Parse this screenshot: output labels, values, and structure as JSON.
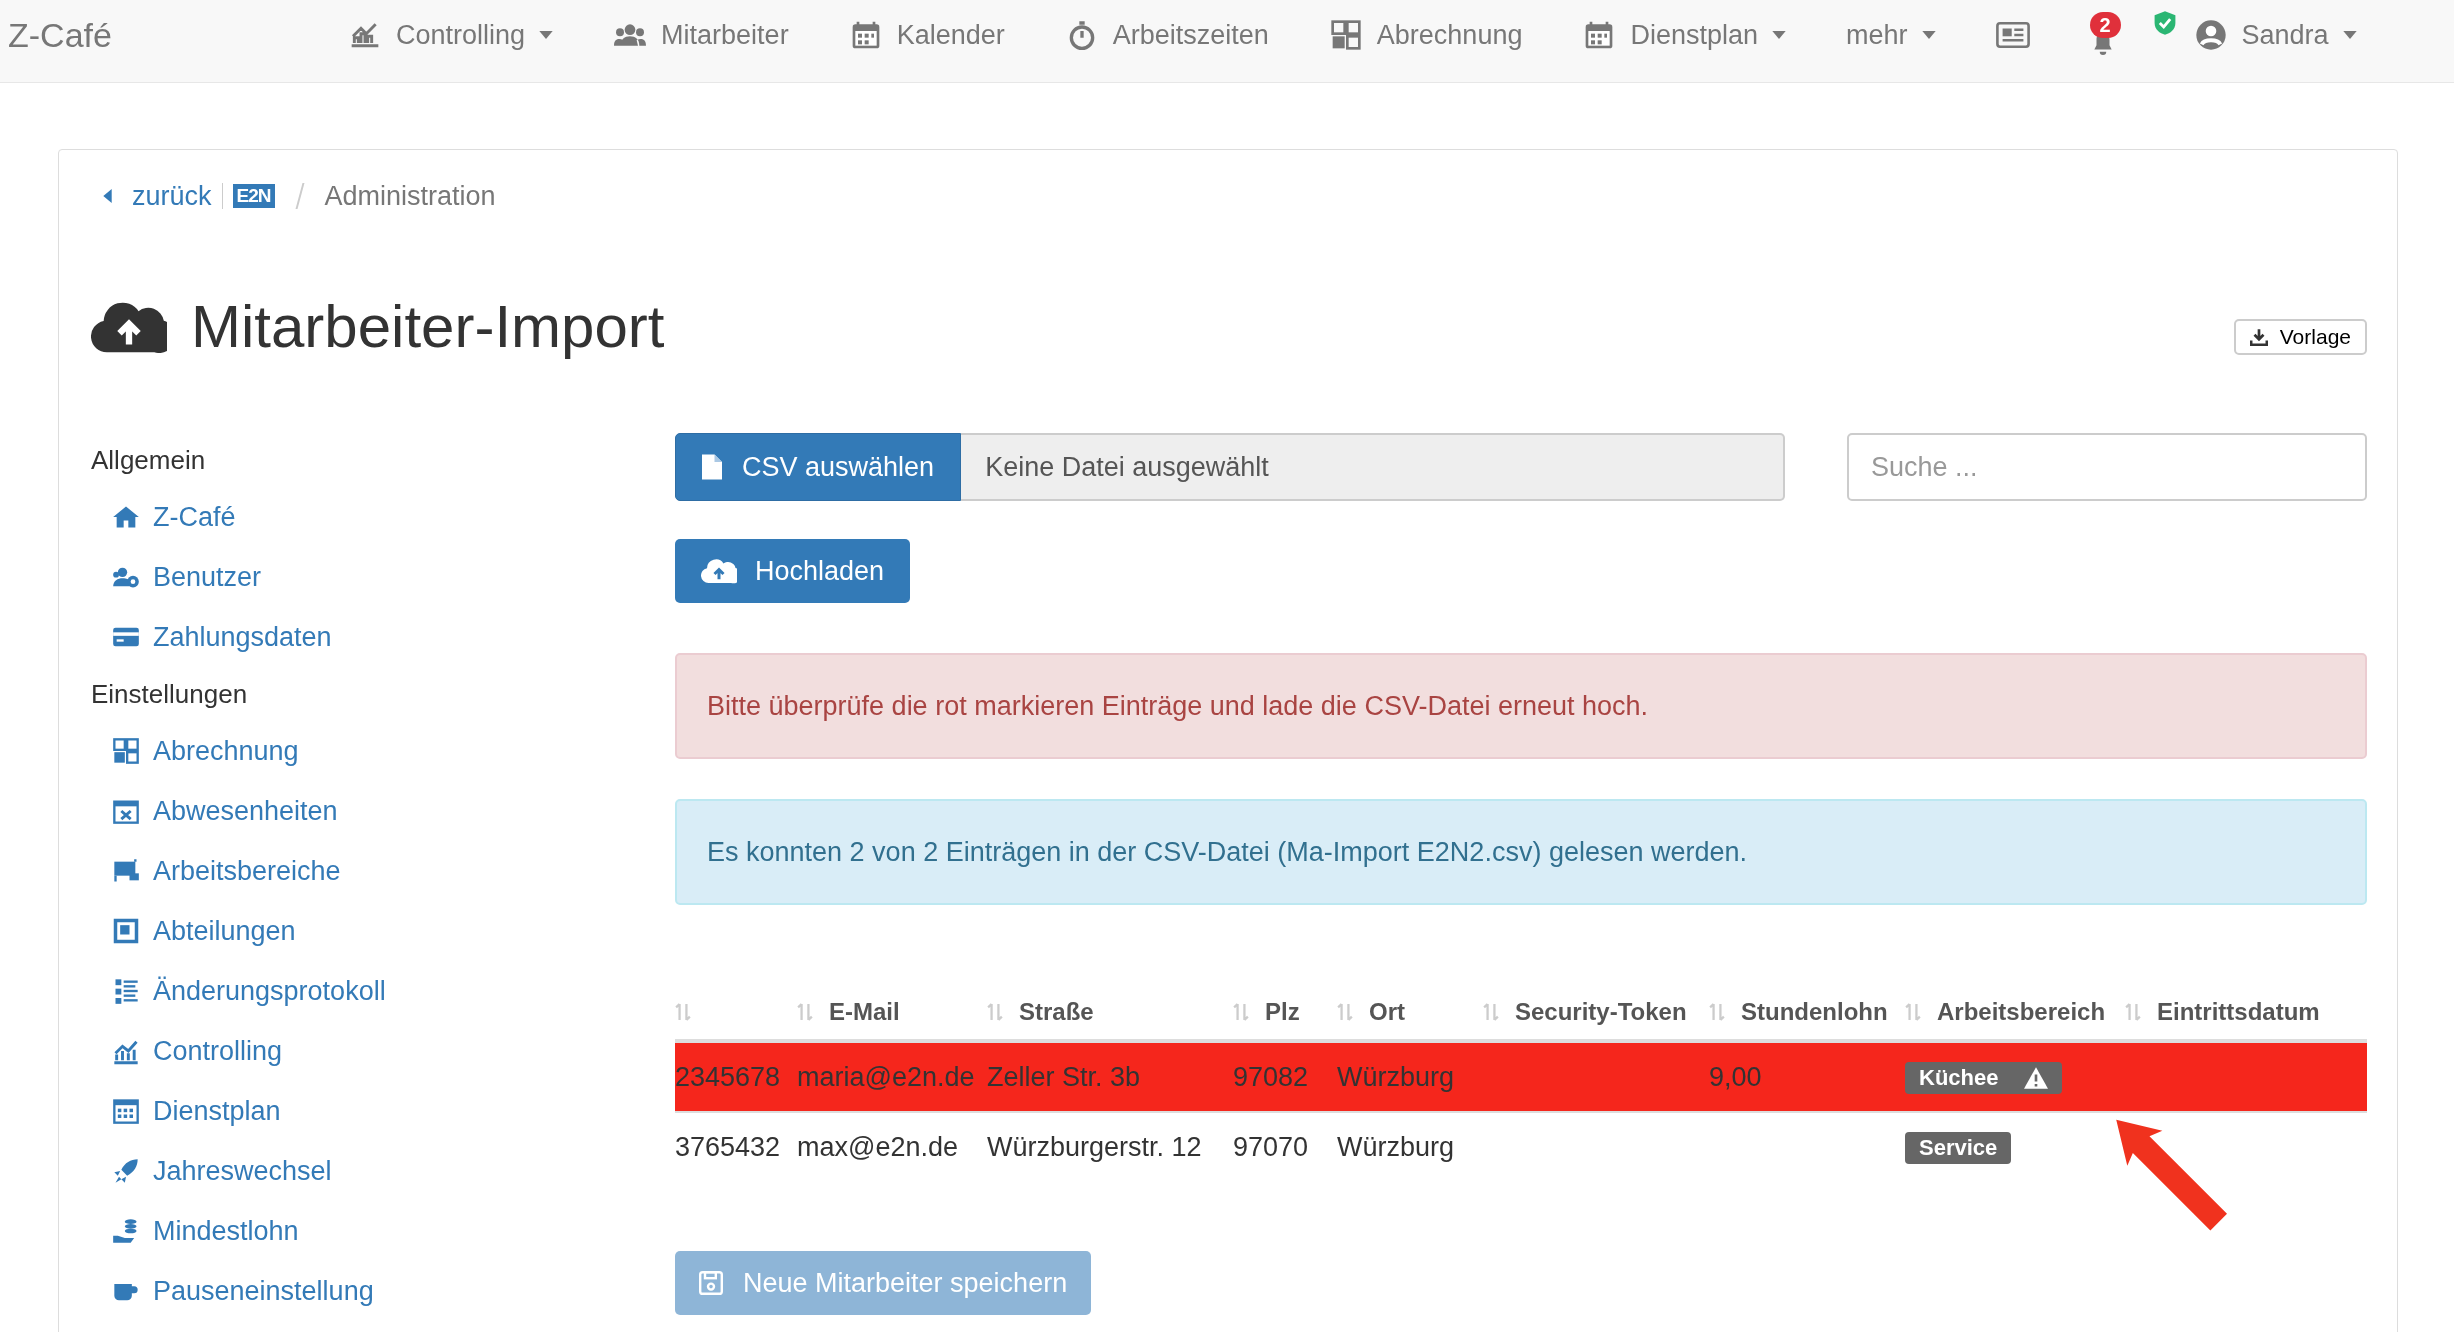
{
  "navbar": {
    "brand": "Z-Café",
    "items": [
      {
        "label": "Controlling",
        "dropdown": true
      },
      {
        "label": "Mitarbeiter",
        "dropdown": false
      },
      {
        "label": "Kalender",
        "dropdown": false
      },
      {
        "label": "Arbeitszeiten",
        "dropdown": false
      },
      {
        "label": "Abrechnung",
        "dropdown": false
      },
      {
        "label": "Dienstplan",
        "dropdown": true
      },
      {
        "label": "mehr",
        "dropdown": true
      }
    ],
    "notification_count": "2",
    "user": "Sandra"
  },
  "breadcrumb": {
    "back": "zurück",
    "logo": "E2N",
    "current": "Administration"
  },
  "page": {
    "title": "Mitarbeiter-Import",
    "template_button": "Vorlage"
  },
  "sidebar": {
    "sections": [
      {
        "heading": "Allgemein",
        "items": [
          "Z-Café",
          "Benutzer",
          "Zahlungsdaten"
        ]
      },
      {
        "heading": "Einstellungen",
        "items": [
          "Abrechnung",
          "Abwesenheiten",
          "Arbeitsbereiche",
          "Abteilungen",
          "Änderungsprotokoll",
          "Controlling",
          "Dienstplan",
          "Jahreswechsel",
          "Mindestlohn",
          "Pauseneinstellung"
        ]
      }
    ]
  },
  "upload": {
    "choose_button": "CSV auswählen",
    "file_name": "Keine Datei ausgewählt",
    "search": {
      "placeholder": "Suche ..."
    },
    "upload_button": "Hochladen"
  },
  "alerts": [
    {
      "kind": "danger",
      "text": "Bitte überprüfe die rot markieren Einträge und lade die CSV-Datei erneut hoch."
    },
    {
      "kind": "info",
      "text": "Es konnten 2 von 2 Einträgen in der CSV-Datei (Ma-Import E2N2.csv) gelesen werden."
    }
  ],
  "table": {
    "columns": [
      "",
      "E-Mail",
      "Straße",
      "Plz",
      "Ort",
      "Security-Token",
      "Stundenlohn",
      "Arbeitsbereich",
      "Eintrittsdatum"
    ],
    "rows": [
      {
        "error": true,
        "cells": [
          "2345678",
          "maria@e2n.de",
          "Zeller Str. 3b",
          "97082",
          "Würzburg",
          "",
          "9,00"
        ],
        "area": {
          "label": "Küchee",
          "warning": true
        }
      },
      {
        "error": false,
        "cells": [
          "3765432",
          "max@e2n.de",
          "Würzburgerstr. 12",
          "97070",
          "Würzburg",
          "",
          ""
        ],
        "area": {
          "label": "Service",
          "warning": false
        }
      }
    ]
  },
  "save_button": {
    "label": "Neue Mitarbeiter speichern",
    "disabled": true
  }
}
